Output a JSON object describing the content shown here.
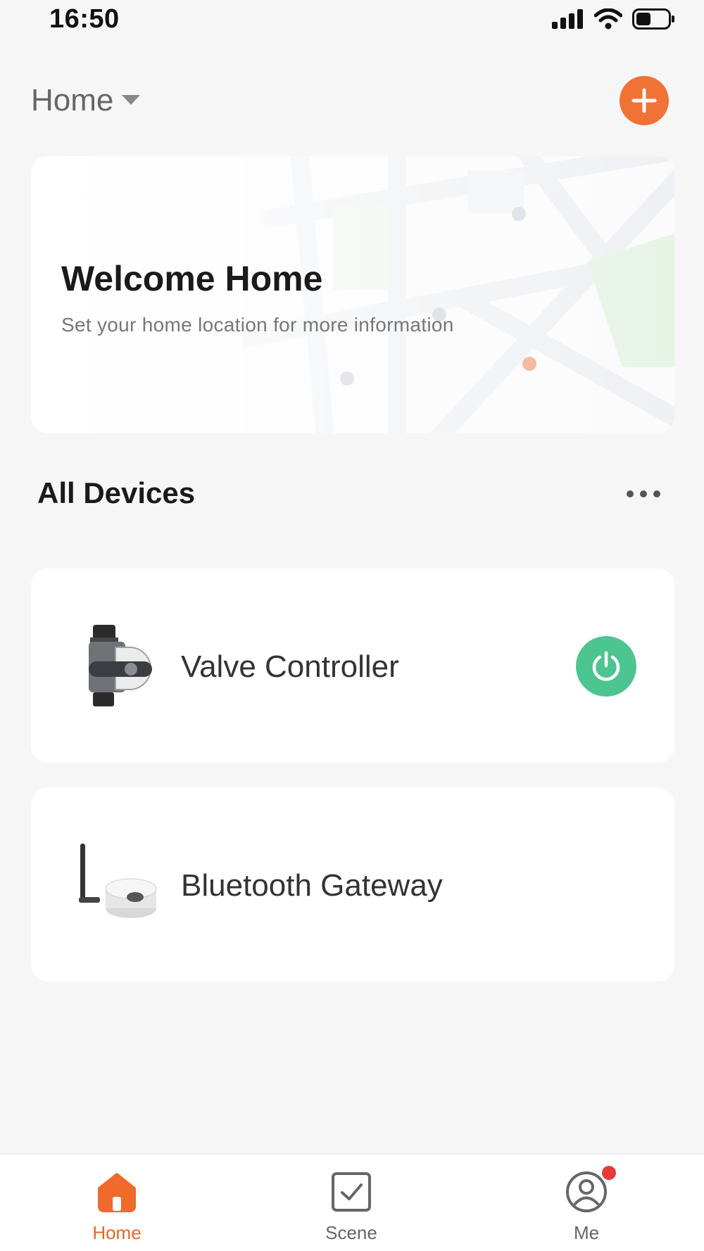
{
  "status_bar": {
    "time": "16:50",
    "icons": [
      "cellular-signal-icon",
      "wifi-icon",
      "battery-icon"
    ]
  },
  "header": {
    "home_label": "Home",
    "dropdown_icon": "caret-down-icon",
    "add_icon": "plus-icon"
  },
  "welcome_card": {
    "title": "Welcome Home",
    "subtitle": "Set your home location for more information"
  },
  "devices": {
    "title": "All Devices",
    "more_icon": "more-horizontal-icon",
    "items": [
      {
        "name": "Valve Controller",
        "icon": "valve-controller-image",
        "power": "power-icon"
      },
      {
        "name": "Bluetooth Gateway",
        "icon": "bluetooth-gateway-image"
      }
    ]
  },
  "bottom_nav": {
    "items": [
      {
        "label": "Home",
        "icon": "home-icon",
        "active": true
      },
      {
        "label": "Scene",
        "icon": "scene-checkbox-icon",
        "active": false
      },
      {
        "label": "Me",
        "icon": "profile-icon",
        "active": false,
        "badge": true
      }
    ]
  },
  "colors": {
    "accent": "#f07234",
    "power_on": "#4cc590",
    "badge": "#e63b3b",
    "background": "#f6f6f6"
  }
}
